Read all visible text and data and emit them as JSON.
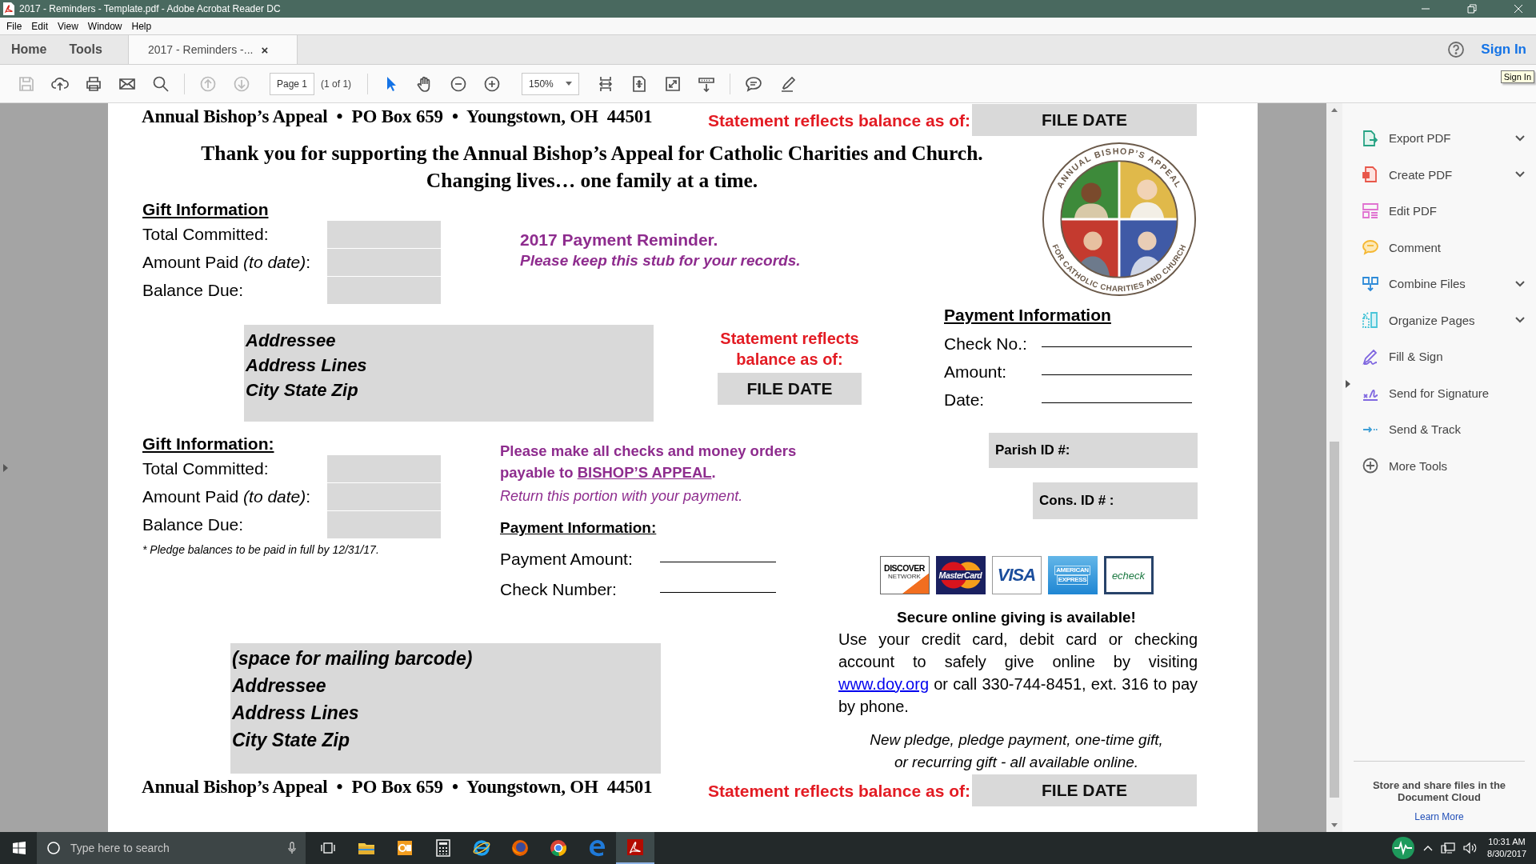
{
  "window": {
    "title": "2017 - Reminders - Template.pdf - Adobe Acrobat Reader DC"
  },
  "menu": [
    "File",
    "Edit",
    "View",
    "Window",
    "Help"
  ],
  "nav_tabs": [
    {
      "label": "Home",
      "selected": false
    },
    {
      "label": "Tools",
      "selected": false
    },
    {
      "label": "2017 - Reminders -...",
      "selected": true,
      "close": "×"
    }
  ],
  "sign_in": "Sign In",
  "tooltip": "Sign In",
  "toolbar": {
    "file_buttons": [
      {
        "kind": "save",
        "disabled": true
      },
      {
        "kind": "upload",
        "disabled": false
      },
      {
        "kind": "print",
        "disabled": false
      },
      {
        "kind": "email",
        "disabled": false
      },
      {
        "kind": "search",
        "disabled": false
      }
    ],
    "nav_buttons": [
      {
        "kind": "previous",
        "disabled": true
      },
      {
        "kind": "next",
        "disabled": true
      }
    ],
    "page_field": "Page 1",
    "page_count": "(1 of 1)",
    "tool_buttons": [
      {
        "kind": "select",
        "selected": true
      },
      {
        "kind": "hand",
        "selected": false
      },
      {
        "kind": "zoom_out",
        "selected": false
      },
      {
        "kind": "zoom_in",
        "selected": false
      }
    ],
    "zoom": "150%",
    "view_buttons": [
      {
        "kind": "fit_width"
      },
      {
        "kind": "fit_page"
      },
      {
        "kind": "full_screen"
      },
      {
        "kind": "scroll_mode"
      }
    ],
    "markup_buttons": [
      {
        "kind": "comment"
      },
      {
        "kind": "highlight"
      }
    ]
  },
  "document": {
    "header": {
      "address": "Annual Bishop’s Appeal  •  PO Box 659  •  Youngstown, OH  44501",
      "statement_label": "Statement reflects balance as of:",
      "file_date": "FILE DATE"
    },
    "thank_you": [
      "Thank you for supporting the Annual Bishop’s Appeal for Catholic Charities and Church.",
      "Changing lives… one family at a time."
    ],
    "gift_info_top": {
      "heading": "Gift Information",
      "rows": [
        "Total Committed:",
        "Amount Paid *(to date)*:",
        "Balance Due:"
      ]
    },
    "reminder": {
      "title": "2017 Payment Reminder.",
      "note": "Please keep this stub for your records."
    },
    "seal": {
      "ring_top": "ANNUAL BISHOP’S APPEAL",
      "ring_bottom": "FOR CATHOLIC CHARITIES AND CHURCH"
    },
    "address_block": [
      "Addressee",
      "Address Lines",
      "City State Zip"
    ],
    "statement_mid": {
      "label": "Statement reflects balance as of:",
      "file_date": "FILE DATE"
    },
    "payment_info_right": {
      "heading": "Payment Information",
      "fields": [
        "Check No.:",
        "Amount:",
        "Date:"
      ]
    },
    "gift_info_bottom": {
      "heading": "Gift Information:",
      "rows": [
        "Total Committed:",
        "Amount Paid *(to date)*:",
        "Balance Due:"
      ],
      "note": "* Pledge balances to be paid in full by 12/31/17."
    },
    "checks_note": {
      "text": "Please make all checks and money orders payable to ",
      "link": "BISHOP’S APPEAL",
      "end": ".",
      "note": "Return this portion with your payment."
    },
    "ids": [
      "Parish ID #:",
      "Cons. ID # :"
    ],
    "payment_info_mid": {
      "heading": "Payment Information:",
      "fields": [
        "Payment Amount:",
        "Check Number:"
      ]
    },
    "payment_methods": [
      {
        "kind": "discover",
        "label": "DISCOVER",
        "sublabel": "NETWORK"
      },
      {
        "kind": "mastercard",
        "label": "MasterCard"
      },
      {
        "kind": "visa",
        "label": "VISA"
      },
      {
        "kind": "amex",
        "label": "AMERICAN",
        "sublabel": "EXPRESS"
      },
      {
        "kind": "echeck",
        "label": "echeck"
      }
    ],
    "online": {
      "heading": "Secure online giving is available!",
      "text_before": "Use your credit card, debit card or checking account to safely give online by visiting ",
      "link": "www.doy.org",
      "text_after": " or call 330-744-8451, ext. 316 to pay by phone.",
      "note_lines": [
        "New pledge, pledge payment, one-time gift,",
        "or recurring gift - all available online."
      ]
    },
    "barcode_block": [
      "(space for mailing barcode)",
      "Addressee",
      "Address Lines",
      "City State Zip"
    ],
    "footer": {
      "address": "Annual Bishop’s Appeal  •  PO Box 659  •  Youngstown, OH  44501",
      "statement_label": "Statement reflects balance as of:",
      "file_date": "FILE DATE"
    }
  },
  "tools_panel": {
    "items": [
      {
        "kind": "export",
        "label": "Export PDF",
        "expandable": true
      },
      {
        "kind": "create",
        "label": "Create PDF",
        "expandable": true
      },
      {
        "kind": "edit",
        "label": "Edit PDF",
        "expandable": false
      },
      {
        "kind": "comment",
        "label": "Comment",
        "expandable": false
      },
      {
        "kind": "combine",
        "label": "Combine Files",
        "expandable": true
      },
      {
        "kind": "organize",
        "label": "Organize Pages",
        "expandable": true
      },
      {
        "kind": "fill_sign",
        "label": "Fill & Sign",
        "expandable": false
      },
      {
        "kind": "send_signature",
        "label": "Send for Signature",
        "expandable": false
      },
      {
        "kind": "send_track",
        "label": "Send & Track",
        "expandable": false
      },
      {
        "kind": "more",
        "label": "More Tools",
        "expandable": false
      }
    ],
    "promo": "Store and share files in the Document Cloud",
    "link": "Learn More"
  },
  "taskbar": {
    "search_placeholder": "Type here to search",
    "apps": [
      {
        "kind": "explorer",
        "active": false
      },
      {
        "kind": "outlook",
        "active": false
      },
      {
        "kind": "calculator",
        "active": false
      },
      {
        "kind": "ie",
        "active": false
      },
      {
        "kind": "firefox",
        "active": false
      },
      {
        "kind": "chrome",
        "active": false
      },
      {
        "kind": "edge",
        "active": false
      },
      {
        "kind": "acrobat",
        "active": true
      }
    ],
    "time": "10:31 AM",
    "date": "8/30/2017"
  }
}
